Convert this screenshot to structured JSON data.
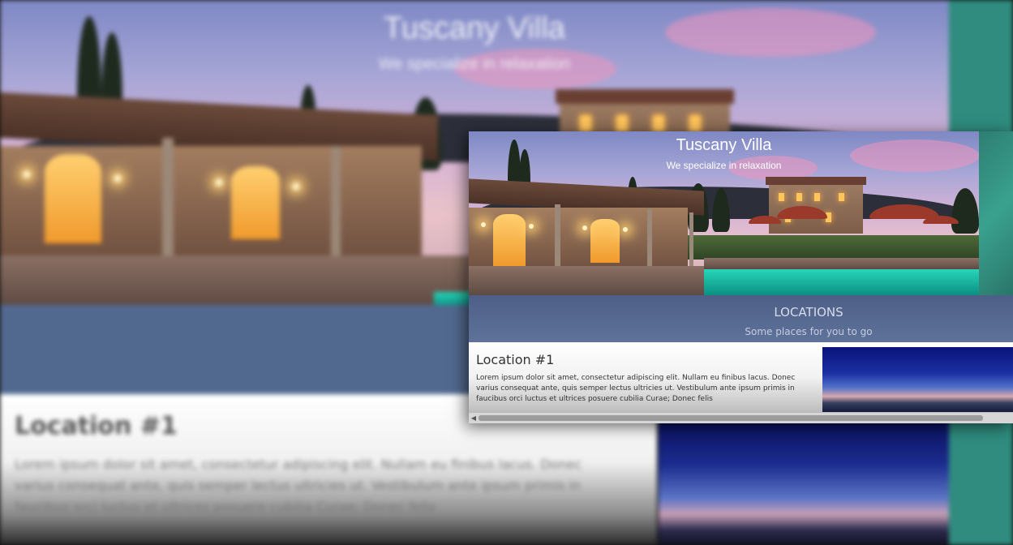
{
  "background_page": {
    "hero": {
      "title": "Tuscany Villa",
      "subtitle": "We specialize in relaxation"
    },
    "location": {
      "title": "Location #1",
      "body": "Lorem ipsum dolor sit amet, consectetur adipiscing elit. Nullam eu finibus lacus. Donec varius consequat ante, quis semper lectus ultricies ut. Vestibulum ante ipsum primis in faucibus orci luctus et ultrices posuere cubilia Curae; Donec felis"
    }
  },
  "foreground_page": {
    "hero": {
      "title": "Tuscany Villa",
      "subtitle": "We specialize in relaxation"
    },
    "locations_band": {
      "title": "LOCATIONS",
      "subtitle": "Some places for you to go"
    },
    "location": {
      "title": "Location #1",
      "body": "Lorem ipsum dolor sit amet, consectetur adipiscing elit. Nullam eu finibus lacus. Donec varius consequat ante, quis semper lectus ultricies ut. Vestibulum ante ipsum primis in faucibus orci luctus et ultrices posuere cubilia Curae; Donec felis"
    },
    "scrollbar": {
      "left_arrow": "◀"
    }
  },
  "colors": {
    "band": "#52698f",
    "map_teal": "#2f8c7e",
    "window_glow": "#ffc45a",
    "pool": "#27d6b8"
  }
}
